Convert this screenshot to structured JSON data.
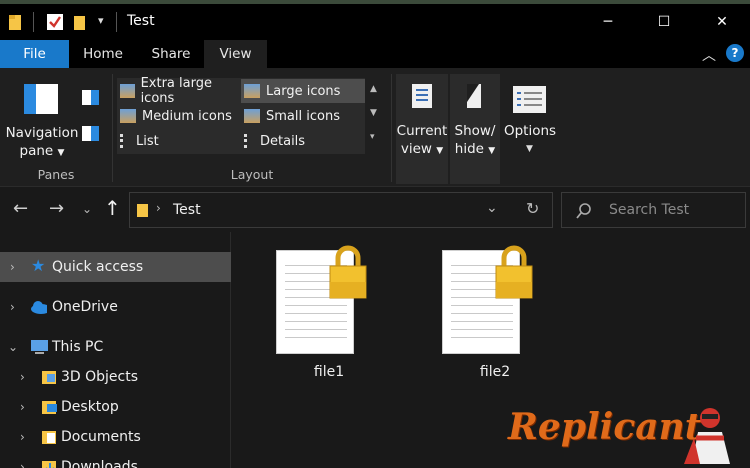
{
  "window": {
    "title": "Test",
    "controls": {
      "minimize": "─",
      "maximize": "☐",
      "close": "✕"
    }
  },
  "tabs": [
    {
      "label": "File"
    },
    {
      "label": "Home"
    },
    {
      "label": "Share"
    },
    {
      "label": "View"
    }
  ],
  "ribbon": {
    "panes": {
      "navigation_pane_label": "Navigation",
      "navigation_pane_label2": "pane",
      "group_label": "Panes"
    },
    "layout": {
      "items": [
        {
          "label": "Extra large icons"
        },
        {
          "label": "Large icons"
        },
        {
          "label": "Medium icons"
        },
        {
          "label": "Small icons"
        },
        {
          "label": "List"
        },
        {
          "label": "Details"
        }
      ],
      "group_label": "Layout"
    },
    "current_view": {
      "line1": "Current",
      "line2": "view"
    },
    "show_hide": {
      "line1": "Show/",
      "line2": "hide"
    },
    "options": {
      "label": "Options"
    }
  },
  "address": {
    "path": "Test",
    "search_placeholder": "Search Test"
  },
  "nav_pane": {
    "items": [
      {
        "label": "Quick access"
      },
      {
        "label": "OneDrive"
      },
      {
        "label": "This PC"
      },
      {
        "label": "3D Objects"
      },
      {
        "label": "Desktop"
      },
      {
        "label": "Documents"
      },
      {
        "label": "Downloads"
      }
    ]
  },
  "files": [
    {
      "name": "file1"
    },
    {
      "name": "file2"
    }
  ],
  "watermark": {
    "text": "Replicant"
  },
  "colors": {
    "accent": "#1979ca",
    "selected": "#4d4d4d",
    "lock": "#f2c12e"
  }
}
